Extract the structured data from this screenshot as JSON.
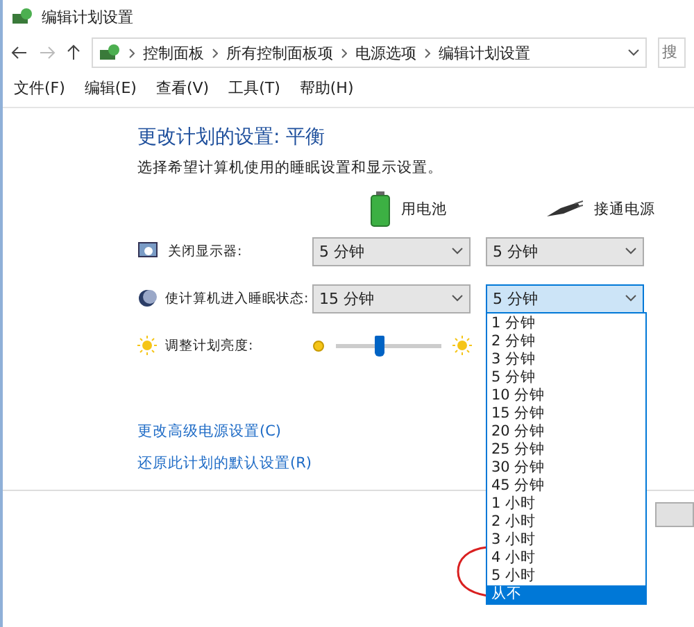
{
  "window": {
    "title": "编辑计划设置"
  },
  "address_bar": {
    "path": [
      "控制面板",
      "所有控制面板项",
      "电源选项",
      "编辑计划设置"
    ]
  },
  "search": {
    "placeholder": "搜"
  },
  "menu": [
    "文件(F)",
    "编辑(E)",
    "查看(V)",
    "工具(T)",
    "帮助(H)"
  ],
  "heading": "更改计划的设置: 平衡",
  "description": "选择希望计算机使用的睡眠设置和显示设置。",
  "columns": [
    {
      "kind": "battery",
      "label": "用电池"
    },
    {
      "kind": "plug",
      "label": "接通电源"
    }
  ],
  "settings": [
    {
      "kind": "display",
      "label": "关闭显示器:",
      "values": [
        {
          "value": "5 分钟",
          "open": false
        },
        {
          "value": "5 分钟",
          "open": false
        }
      ]
    },
    {
      "kind": "sleep",
      "label": "使计算机进入睡眠状态:",
      "values": [
        {
          "value": "15 分钟",
          "open": false
        },
        {
          "value": "5 分钟",
          "open": true
        }
      ]
    },
    {
      "kind": "brightness",
      "label": "调整计划亮度:",
      "level": 0.41
    }
  ],
  "dropdown_options": [
    {
      "label": "1 分钟",
      "selected": false
    },
    {
      "label": "2 分钟",
      "selected": false
    },
    {
      "label": "3 分钟",
      "selected": false
    },
    {
      "label": "5 分钟",
      "selected": false
    },
    {
      "label": "10 分钟",
      "selected": false
    },
    {
      "label": "15 分钟",
      "selected": false
    },
    {
      "label": "20 分钟",
      "selected": false
    },
    {
      "label": "25 分钟",
      "selected": false
    },
    {
      "label": "30 分钟",
      "selected": false
    },
    {
      "label": "45 分钟",
      "selected": false
    },
    {
      "label": "1 小时",
      "selected": false
    },
    {
      "label": "2 小时",
      "selected": false
    },
    {
      "label": "3 小时",
      "selected": false
    },
    {
      "label": "4 小时",
      "selected": false
    },
    {
      "label": "5 小时",
      "selected": false
    },
    {
      "label": "从不",
      "selected": true
    }
  ],
  "links": [
    "更改高级电源设置(C)",
    "还原此计划的默认设置(R)"
  ]
}
